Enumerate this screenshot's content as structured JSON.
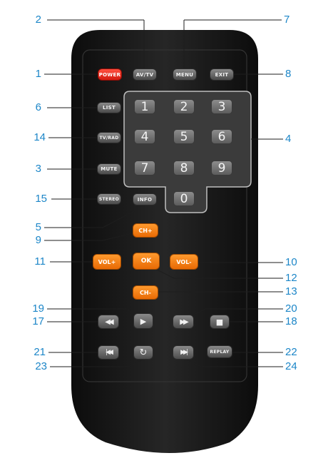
{
  "remote": {
    "buttons": {
      "power": "POWER",
      "av_tv": "AV/TV",
      "menu": "MENU",
      "exit": "EXIT",
      "list": "LIST",
      "tv_rad": "TV/RAD",
      "mute": "MUTE",
      "stereo": "STEREO",
      "info": "INFO",
      "ch_up": "CH+",
      "ch_down": "CH-",
      "vol_down": "VOL-",
      "vol_up": "VOL+",
      "ok": "OK",
      "replay": "REPLAY"
    },
    "digits": [
      "1",
      "2",
      "3",
      "4",
      "5",
      "6",
      "7",
      "8",
      "9",
      "0"
    ],
    "media_icons": {
      "rewind": "◀◀",
      "play": "▶",
      "fast_forward": "▶▶",
      "stop": "■",
      "previous": "|◀◀",
      "repeat": "↻",
      "next": "▶▶|"
    }
  },
  "callouts": {
    "n1": "1",
    "n2": "2",
    "n3": "3",
    "n4": "4",
    "n5": "5",
    "n6": "6",
    "n7": "7",
    "n8": "8",
    "n9": "9",
    "n10": "10",
    "n11": "11",
    "n12": "12",
    "n13": "13",
    "n14": "14",
    "n15": "15",
    "n17": "17",
    "n18": "18",
    "n19": "19",
    "n20": "20",
    "n21": "21",
    "n22": "22",
    "n23": "23",
    "n24": "24"
  },
  "colors": {
    "callout": "#1c86c8",
    "remote_body": "#1a1a1a",
    "power_button": "#e8251a",
    "nav_buttons": "#f07d12"
  }
}
